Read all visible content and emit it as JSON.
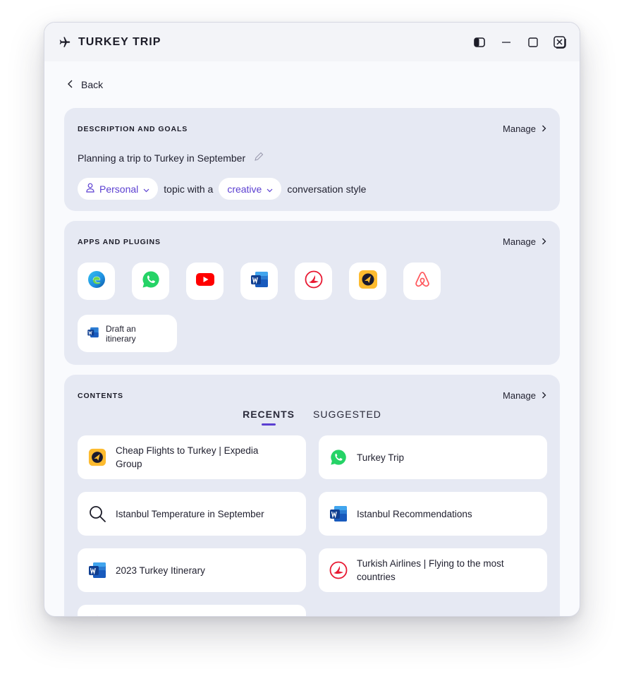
{
  "window": {
    "title": "TURKEY TRIP"
  },
  "nav": {
    "back_label": "Back"
  },
  "description": {
    "heading": "DESCRIPTION AND GOALS",
    "manage_label": "Manage",
    "text": "Planning a trip to Turkey in September",
    "topic_value": "Personal",
    "mid_text": "topic with a",
    "style_value": "creative",
    "end_text": "conversation style"
  },
  "apps": {
    "heading": "APPS AND PLUGINS",
    "manage_label": "Manage",
    "icons": [
      "edge-icon",
      "whatsapp-icon",
      "youtube-icon",
      "word-icon",
      "turkish-airlines-icon",
      "expedia-icon",
      "airbnb-icon"
    ],
    "suggestion_label": "Draft an itinerary"
  },
  "contents": {
    "heading": "CONTENTS",
    "manage_label": "Manage",
    "tabs": [
      {
        "label": "RECENTS",
        "active": true
      },
      {
        "label": "SUGGESTED",
        "active": false
      }
    ],
    "items": [
      {
        "label": "Cheap Flights to Turkey | Expedia Group",
        "icon": "expedia-icon"
      },
      {
        "label": "Turkey Trip",
        "icon": "whatsapp-icon"
      },
      {
        "label": "Istanbul Temperature in September",
        "icon": "search-icon"
      },
      {
        "label": "Istanbul Recommendations",
        "icon": "word-icon"
      },
      {
        "label": "2023 Turkey Itinerary",
        "icon": "word-icon"
      },
      {
        "label": "Turkish Airlines | Flying to the most countries",
        "icon": "turkish-airlines-icon"
      },
      {
        "label": "",
        "icon": "airbnb-icon"
      }
    ]
  },
  "colors": {
    "accent": "#5b3fd1",
    "card_bg": "#e6e9f3",
    "window_bg": "#f9fafd"
  }
}
